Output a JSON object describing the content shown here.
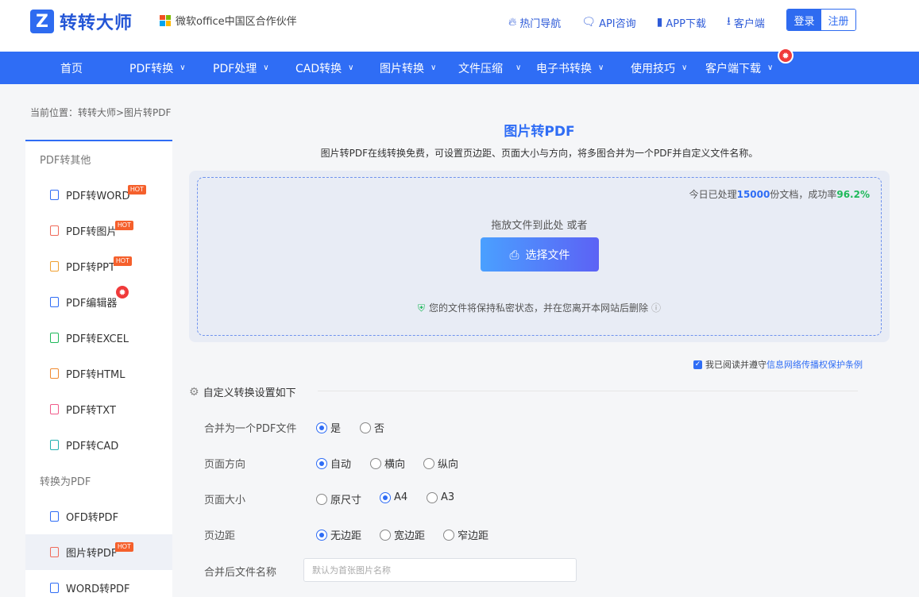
{
  "header": {
    "logo_text": "转转大师",
    "partner": "微软office中国区合作伙伴",
    "links": [
      {
        "label": "热门导航",
        "icon": "fire-icon"
      },
      {
        "label": "API咨询",
        "icon": "chat-icon"
      },
      {
        "label": "APP下载",
        "icon": "phone-icon"
      },
      {
        "label": "客户端",
        "icon": "download-icon"
      }
    ],
    "login": "登录",
    "register": "注册"
  },
  "nav": {
    "items": [
      {
        "label": "首页"
      },
      {
        "label": "PDF转换"
      },
      {
        "label": "PDF处理"
      },
      {
        "label": "CAD转换"
      },
      {
        "label": "图片转换"
      },
      {
        "label": "文件压缩"
      },
      {
        "label": "电子书转换"
      },
      {
        "label": "使用技巧"
      },
      {
        "label": "客户端下载"
      }
    ]
  },
  "breadcrumb": "当前位置：转转大师>图片转PDF",
  "sidebar": {
    "groups": [
      {
        "title": "PDF转其他"
      },
      {
        "title": "转换为PDF"
      }
    ],
    "items": [
      {
        "label": "PDF转WORD",
        "badge": "HOT",
        "color": "#2f6df5"
      },
      {
        "label": "PDF转图片",
        "badge": "HOT",
        "color": "#f06a5a"
      },
      {
        "label": "PDF转PPT",
        "badge": "HOT",
        "color": "#f0a030"
      },
      {
        "label": "PDF编辑器",
        "badge": "fire",
        "color": "#2f6df5"
      },
      {
        "label": "PDF转EXCEL",
        "badge": "",
        "color": "#1fb95a"
      },
      {
        "label": "PDF转HTML",
        "badge": "",
        "color": "#f08a30"
      },
      {
        "label": "PDF转TXT",
        "badge": "",
        "color": "#f05a8a"
      },
      {
        "label": "PDF转CAD",
        "badge": "",
        "color": "#20b0b0"
      },
      {
        "label": "OFD转PDF",
        "badge": "",
        "color": "#2f6df5"
      },
      {
        "label": "图片转PDF",
        "badge": "HOT",
        "color": "#f06a5a"
      },
      {
        "label": "WORD转PDF",
        "badge": "",
        "color": "#2f6df5"
      }
    ]
  },
  "main": {
    "title": "图片转PDF",
    "subtitle": "图片转PDF在线转换免费，可设置页边距、页面大小与方向，将多图合并为一个PDF并自定义文件名称。",
    "stats_prefix": "今日已处理",
    "stats_count": "15000",
    "stats_mid": "份文档，成功率",
    "stats_rate": "96.2%",
    "drop_hint": "拖放文件到此处 或者",
    "choose_button": "选择文件",
    "privacy": "您的文件将保持私密状态，并在您离开本网站后删除",
    "agree_prefix": "我已阅读并遵守",
    "agree_link": "信息网络传播权保护条例",
    "settings_title": "自定义转换设置如下"
  },
  "settings": {
    "merge": {
      "label": "合并为一个PDF文件",
      "options": [
        "是",
        "否"
      ],
      "selected": "是"
    },
    "orientation": {
      "label": "页面方向",
      "options": [
        "自动",
        "横向",
        "纵向"
      ],
      "selected": "自动"
    },
    "size": {
      "label": "页面大小",
      "options": [
        "原尺寸",
        "A4",
        "A3"
      ],
      "selected": "A4"
    },
    "margin": {
      "label": "页边距",
      "options": [
        "无边距",
        "宽边距",
        "窄边距"
      ],
      "selected": "无边距"
    },
    "filename": {
      "label": "合并后文件名称",
      "placeholder": "默认为首张图片名称"
    }
  }
}
